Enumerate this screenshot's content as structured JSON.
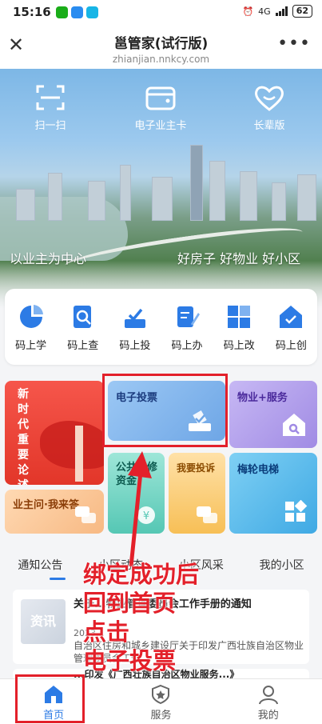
{
  "status": {
    "time": "15:16",
    "network": "4G",
    "battery": "62"
  },
  "header": {
    "title": "邕管家(试行版)",
    "domain": "zhianjian.nnkcy.com"
  },
  "hero": {
    "actions": [
      {
        "label": "扫一扫",
        "icon": "scan-icon"
      },
      {
        "label": "电子业主卡",
        "icon": "wallet-card-icon"
      },
      {
        "label": "长辈版",
        "icon": "heart-smile-icon"
      }
    ],
    "slogan_left": "以业主为中心",
    "slogan_right": "好房子 好物业 好小区"
  },
  "quick": [
    {
      "label": "码上学",
      "icon": "pie-chart-icon"
    },
    {
      "label": "码上查",
      "icon": "search-doc-icon"
    },
    {
      "label": "码上投",
      "icon": "vote-box-icon"
    },
    {
      "label": "码上办",
      "icon": "edit-doc-icon"
    },
    {
      "label": "码上改",
      "icon": "grid-blocks-icon"
    },
    {
      "label": "码上创",
      "icon": "home-badge-icon"
    }
  ],
  "tiles": {
    "news": "新时代重要论述",
    "vote": "电子投票",
    "property": "物业+服务",
    "qa": "业主问·我来答",
    "fund": "公共维修资金",
    "complain": "我要投诉",
    "elevator": "梅轮电梯"
  },
  "tabs": [
    "通知公告",
    "小区动态",
    "小区风采",
    "我的小区"
  ],
  "article": {
    "thumb": "资讯",
    "title": "关于...物业管理委员会工作手册的通知",
    "date": "2023...",
    "summary": "自治区住房和城乡建设厅关于印发广西壮族自治区物业管理委员会工作..."
  },
  "article2_title": "...印发《广西壮族自治区物业服务...》",
  "nav": [
    {
      "label": "首页",
      "icon": "home-icon"
    },
    {
      "label": "服务",
      "icon": "star-badge-icon"
    },
    {
      "label": "我的",
      "icon": "user-icon"
    }
  ],
  "annotation": [
    "绑定成功后",
    "回到首页",
    "点击",
    "电子投票"
  ],
  "colors": {
    "accent": "#2c7be5",
    "annotation": "#e3202a"
  }
}
